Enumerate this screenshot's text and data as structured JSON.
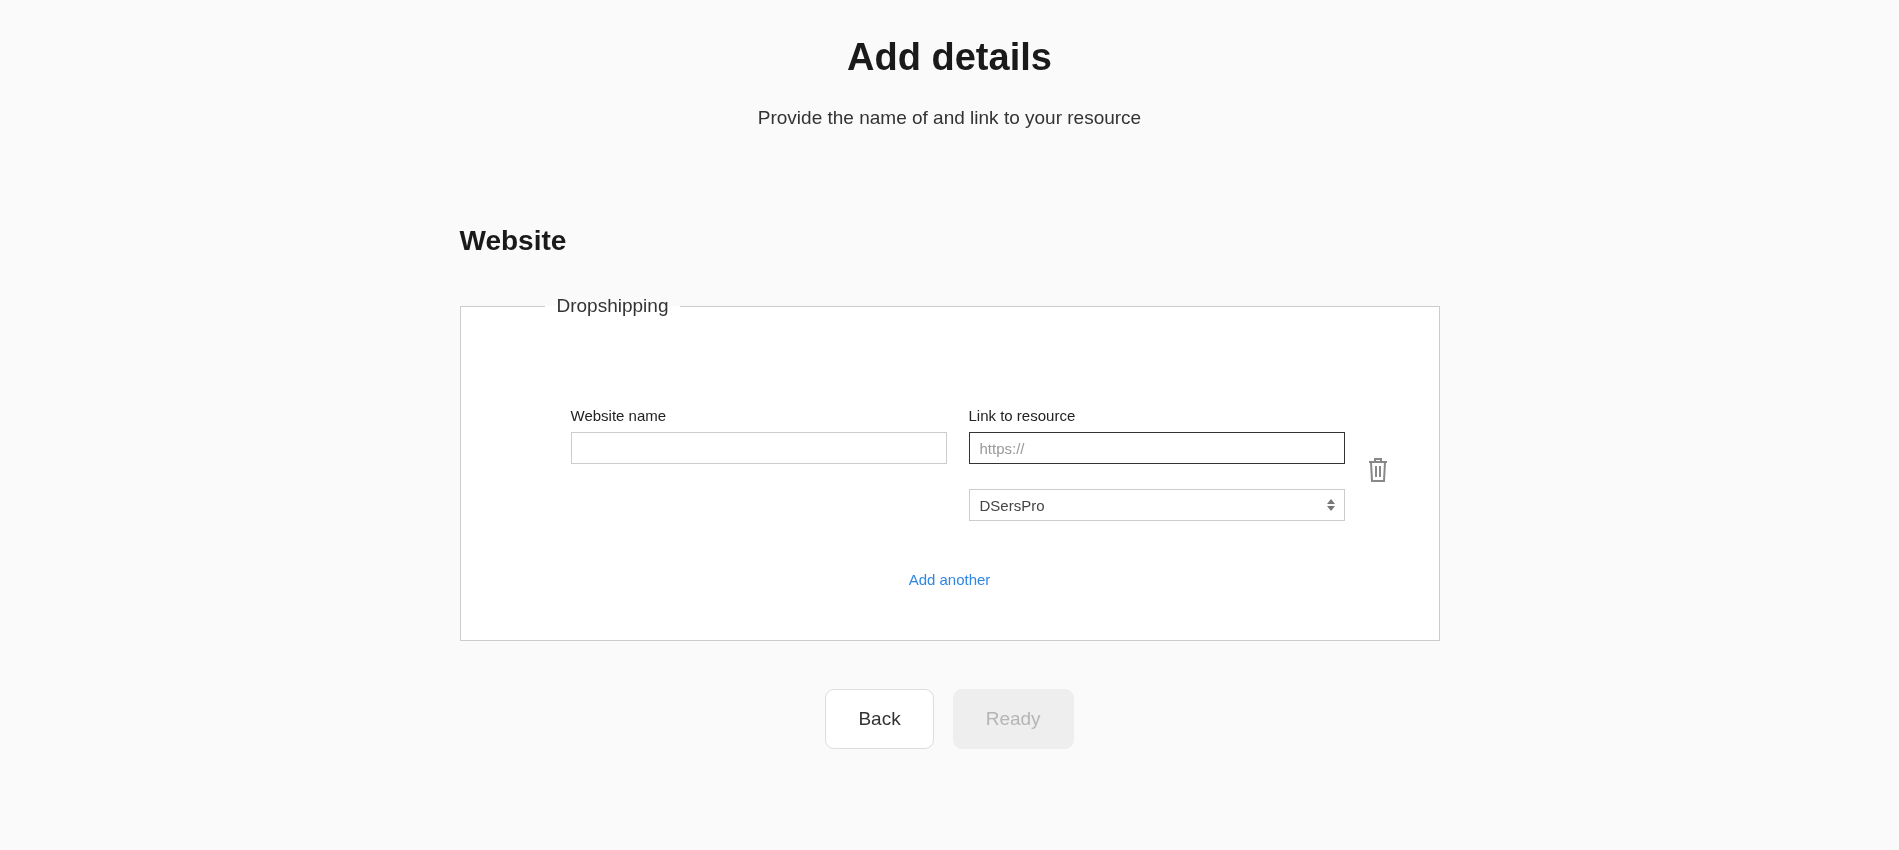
{
  "header": {
    "title": "Add details",
    "subtitle": "Provide the name of and link to your resource"
  },
  "section": {
    "title": "Website",
    "group": {
      "legend": "Dropshipping",
      "fields": [
        {
          "kind": "text",
          "label": "Website name",
          "focused": false
        },
        {
          "kind": "text",
          "label": "Link to resource",
          "placeholder": "https://",
          "focused": true
        }
      ],
      "select": {
        "value": "DSersPro"
      },
      "add_link": "Add another"
    }
  },
  "buttons": [
    {
      "label": "Back",
      "disabled": false
    },
    {
      "label": "Ready",
      "disabled": true
    }
  ]
}
